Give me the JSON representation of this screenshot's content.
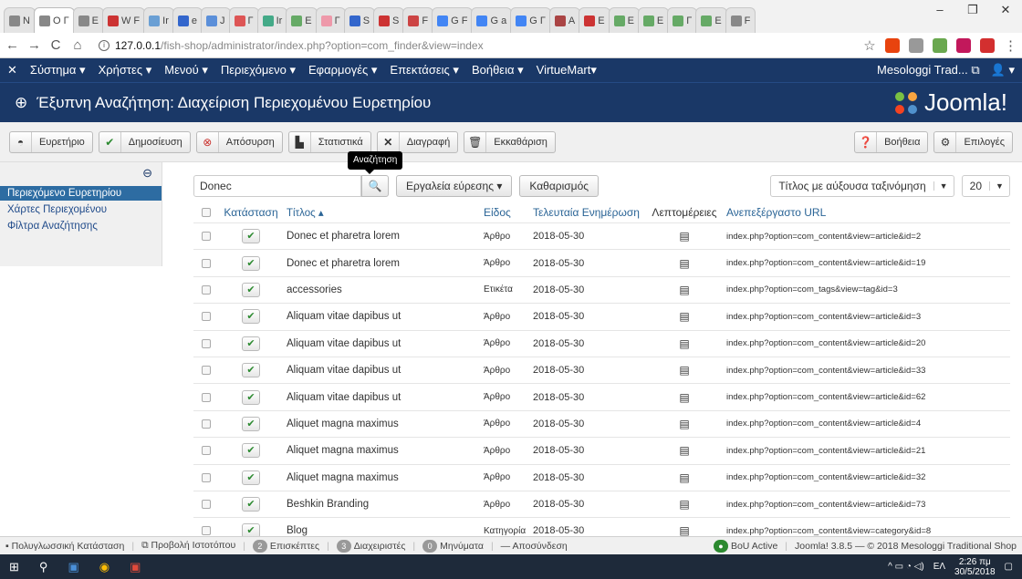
{
  "browser": {
    "tabs": [
      "N",
      "O Γ",
      "E",
      "W F",
      "Ir",
      "e",
      "J",
      "Γ",
      "Ir",
      "E",
      "Γ",
      "S",
      "S",
      "F",
      "G F",
      "G a",
      "G Γ",
      "A",
      "E",
      "E",
      "E",
      "Γ",
      "E",
      "F"
    ],
    "url_host": "127.0.0.1",
    "url_path": "/fish-shop/administrator/index.php?option=com_finder&view=index",
    "window_controls": [
      "–",
      "❐",
      "✕"
    ]
  },
  "colors": {
    "navy": "#1a3867",
    "link": "#2a6496",
    "accent": "#2d6ca2"
  },
  "adminnav": {
    "menu": [
      "Σύστημα ▾",
      "Χρήστες ▾",
      "Μενού ▾",
      "Περιεχόμενο ▾",
      "Εφαρμογές ▾",
      "Επεκτάσεις ▾",
      "Βοήθεια ▾",
      "VirtueMart▾"
    ],
    "site_name": "Mesologgi Trad...",
    "user_menu": "▾"
  },
  "page": {
    "title": "Έξυπνη Αναζήτηση: Διαχείριση Περιεχομένου Ευρετηρίου",
    "logo_text": "Joomla!"
  },
  "toolbar": {
    "buttons": [
      {
        "label": "Ευρετήριο",
        "icon": "eye-icon"
      },
      {
        "label": "Δημοσίευση",
        "icon": "check-icon"
      },
      {
        "label": "Απόσυρση",
        "icon": "unpublish-icon"
      },
      {
        "label": "Στατιστικά",
        "icon": "chart-icon"
      },
      {
        "label": "Διαγραφή",
        "icon": "delete-icon"
      },
      {
        "label": "Εκκαθάριση",
        "icon": "trash-icon"
      }
    ],
    "help_label": "Βοήθεια",
    "options_label": "Επιλογές"
  },
  "sidebar": {
    "items": [
      "Περιεχόμενο Ευρετηρίου",
      "Χάρτες Περιεχομένου",
      "Φίλτρα Αναζήτησης"
    ]
  },
  "filters": {
    "search_value": "Donec",
    "search_tooltip": "Αναζήτηση",
    "tools_label": "Εργαλεία εύρεσης ▾",
    "clear_label": "Καθαρισμός",
    "sort_value": "Τίτλος με αύξουσα ταξινόμηση",
    "limit_value": "20"
  },
  "table": {
    "headers": {
      "state": "Κατάσταση",
      "title": "Τίτλος ▴",
      "type": "Είδος",
      "updated": "Τελευταία Ενημέρωση",
      "details": "Λεπτομέρειες",
      "url": "Ανεπεξέργαστο URL"
    },
    "rows": [
      {
        "title": "Donec et pharetra lorem",
        "type": "Άρθρο",
        "date": "2018-05-30",
        "url": "index.php?option=com_content&view=article&id=2"
      },
      {
        "title": "Donec et pharetra lorem",
        "type": "Άρθρο",
        "date": "2018-05-30",
        "url": "index.php?option=com_content&view=article&id=19"
      },
      {
        "title": "accessories",
        "type": "Ετικέτα",
        "date": "2018-05-30",
        "url": "index.php?option=com_tags&view=tag&id=3"
      },
      {
        "title": "Aliquam vitae dapibus ut",
        "type": "Άρθρο",
        "date": "2018-05-30",
        "url": "index.php?option=com_content&view=article&id=3"
      },
      {
        "title": "Aliquam vitae dapibus ut",
        "type": "Άρθρο",
        "date": "2018-05-30",
        "url": "index.php?option=com_content&view=article&id=20"
      },
      {
        "title": "Aliquam vitae dapibus ut",
        "type": "Άρθρο",
        "date": "2018-05-30",
        "url": "index.php?option=com_content&view=article&id=33"
      },
      {
        "title": "Aliquam vitae dapibus ut",
        "type": "Άρθρο",
        "date": "2018-05-30",
        "url": "index.php?option=com_content&view=article&id=62"
      },
      {
        "title": "Aliquet magna maximus",
        "type": "Άρθρο",
        "date": "2018-05-30",
        "url": "index.php?option=com_content&view=article&id=4"
      },
      {
        "title": "Aliquet magna maximus",
        "type": "Άρθρο",
        "date": "2018-05-30",
        "url": "index.php?option=com_content&view=article&id=21"
      },
      {
        "title": "Aliquet magna maximus",
        "type": "Άρθρο",
        "date": "2018-05-30",
        "url": "index.php?option=com_content&view=article&id=32"
      },
      {
        "title": "Beshkin Branding",
        "type": "Άρθρο",
        "date": "2018-05-30",
        "url": "index.php?option=com_content&view=article&id=73"
      },
      {
        "title": "Blog",
        "type": "Κατηγορία",
        "date": "2018-05-30",
        "url": "index.php?option=com_content&view=category&id=8"
      }
    ]
  },
  "statusbar": {
    "multilang": "Πολυγλωσσική Κατάσταση",
    "preview": "Προβολή Ιστοτόπου",
    "visitors_count": "2",
    "visitors": "Επισκέπτες",
    "admins_count": "3",
    "admins": "Διαχειριστές",
    "messages_count": "0",
    "messages": "Μηνύματα",
    "logout": "Αποσύνδεση",
    "bou": "BoU Active",
    "version": "Joomla! 3.8.5 — © 2018 Mesologgi Traditional Shop"
  },
  "taskbar": {
    "lang": "ΕΛ",
    "time": "2:26 πμ",
    "date": "30/5/2018"
  }
}
